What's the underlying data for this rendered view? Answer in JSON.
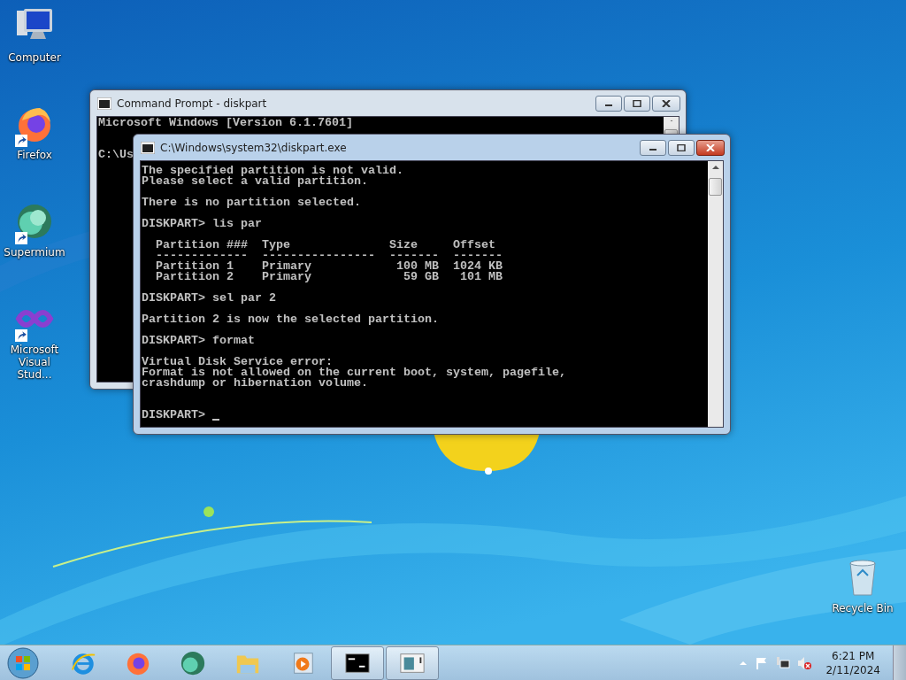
{
  "desktop": {
    "icons": [
      {
        "label": "Computer",
        "kind": "computer",
        "shortcut": false
      },
      {
        "label": "Firefox",
        "kind": "firefox",
        "shortcut": true
      },
      {
        "label": "Supermium",
        "kind": "supermium",
        "shortcut": true
      },
      {
        "label": "Microsoft Visual Stud...",
        "kind": "vstudio",
        "shortcut": true
      }
    ],
    "recycle_bin": {
      "label": "Recycle Bin"
    }
  },
  "windows": [
    {
      "title": "Command Prompt - diskpart",
      "active": false,
      "blocks": [
        [
          "Microsoft Windows [Version 6.1.7601]"
        ],
        [
          "C:\\Us"
        ]
      ]
    },
    {
      "title": "C:\\Windows\\system32\\diskpart.exe",
      "active": true,
      "blocks": [
        [
          "The specified partition is not valid.",
          "Please select a valid partition."
        ],
        [
          "There is no partition selected."
        ],
        [
          "DISKPART> lis par"
        ],
        [
          "  Partition ###  Type              Size     Offset",
          "  -------------  ----------------  -------  -------",
          "  Partition 1    Primary            100 MB  1024 KB",
          "  Partition 2    Primary             59 GB   101 MB"
        ],
        [
          "DISKPART> sel par 2"
        ],
        [
          "Partition 2 is now the selected partition."
        ],
        [
          "DISKPART> format"
        ],
        [
          "Virtual Disk Service error:",
          "Format is not allowed on the current boot, system, pagefile,",
          "crashdump or hibernation volume."
        ]
      ],
      "prompt": {
        "text": "DISKPART>",
        "cursor": true
      }
    }
  ],
  "taskbar": {
    "apps": [
      {
        "kind": "ie",
        "running": false
      },
      {
        "kind": "firefox",
        "running": false
      },
      {
        "kind": "supermium",
        "running": false
      },
      {
        "kind": "explorer",
        "running": false
      },
      {
        "kind": "media",
        "running": false
      },
      {
        "kind": "cmd",
        "running": true
      },
      {
        "kind": "diskpart",
        "running": true
      }
    ],
    "tray": {
      "time": "6:21 PM",
      "date": "2/11/2024",
      "volume_muted": true
    }
  }
}
